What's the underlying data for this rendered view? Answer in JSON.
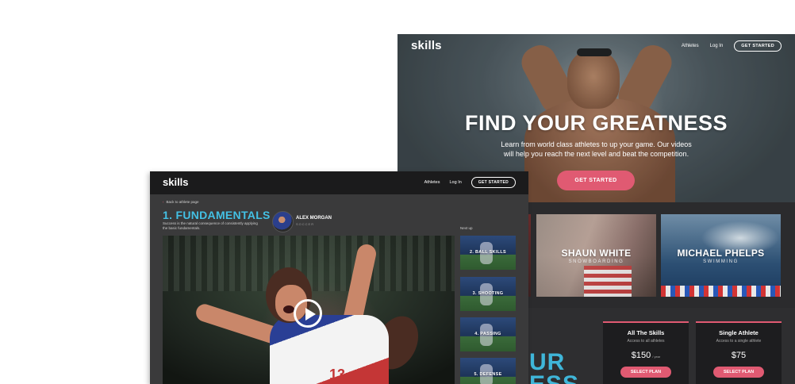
{
  "landing": {
    "logo": "skills",
    "nav": {
      "athletes": "Athletes",
      "login": "Log In",
      "cta": "GET STARTED"
    },
    "hero": {
      "title": "FIND YOUR GREATNESS",
      "subtitle_line1": "Learn from world class athletes to up your game. Our videos",
      "subtitle_line2": "will help you reach the next level and beat the competition.",
      "cta": "GET STARTED"
    },
    "athletes": [
      {
        "name": "SHAUN WHITE",
        "sport": "SNOWBOARDING"
      },
      {
        "name": "MICHAEL PHELPS",
        "sport": "SWIMMING"
      }
    ],
    "big_text": [
      "UR",
      "ESS"
    ],
    "plans": [
      {
        "name": "All The Skills",
        "desc": "Access to all athletes",
        "price": "$150",
        "period": "/ year",
        "button": "SELECT PLAN"
      },
      {
        "name": "Single Athlete",
        "desc": "Access to a single athlete",
        "price": "$75",
        "period": "",
        "button": "SELECT PLAN"
      }
    ]
  },
  "lesson": {
    "logo": "skills",
    "nav": {
      "athletes": "Athletes",
      "login": "Log In",
      "cta": "GET STARTED"
    },
    "back_link": "Back to athlete page",
    "title": "1. FUNDAMENTALS",
    "description": "Success is the natural consequence of consistently applying the basic fundamentals.",
    "athlete": {
      "name": "ALEX MORGAN",
      "sport": "SOCCER"
    },
    "video": {
      "jersey_number": "13"
    },
    "next_up_label": "Next up",
    "next_up": [
      "2. BALL SKILLS",
      "3. SHOOTING",
      "4. PASSING",
      "5. DEFENSE"
    ]
  },
  "colors": {
    "accent_pink": "#e05a72",
    "accent_blue": "#43c0e4",
    "dark_bg": "#3a3a3b"
  }
}
